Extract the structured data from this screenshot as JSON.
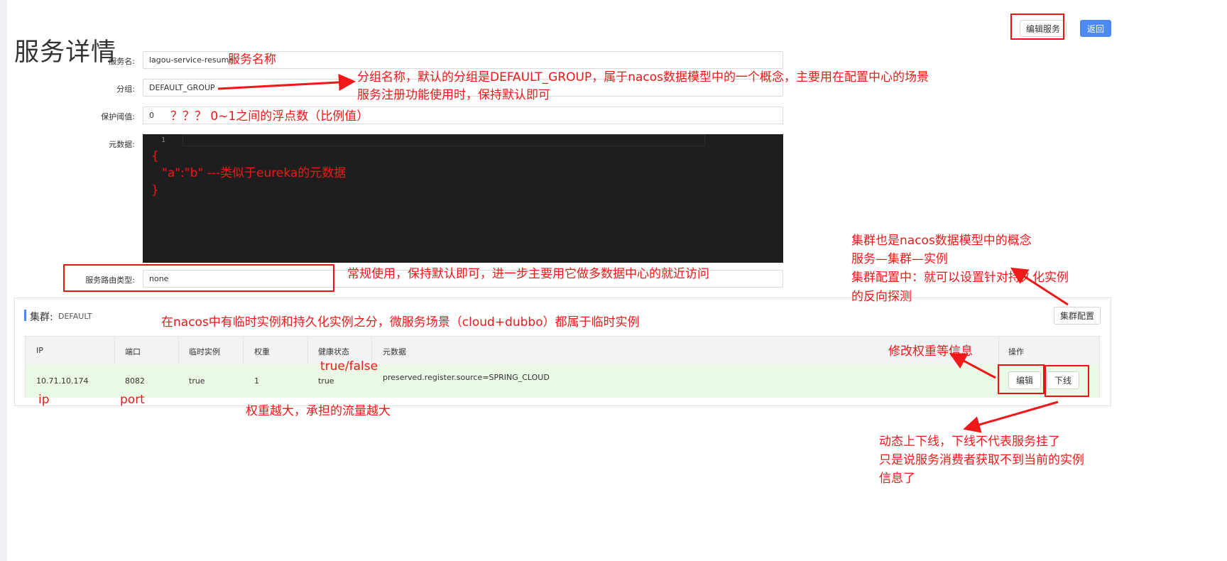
{
  "page": {
    "title": "服务详情"
  },
  "header": {
    "edit_service": "编辑服务",
    "back": "返回"
  },
  "form": {
    "service_name_label": "服务名:",
    "service_name_value": "lagou-service-resume",
    "group_label": "分组:",
    "group_value": "DEFAULT_GROUP",
    "threshold_label": "保护阈值:",
    "threshold_value": "0",
    "metadata_label": "元数据:",
    "editor_line": "1",
    "route_type_label": "服务路由类型:",
    "route_type_value": "none"
  },
  "cluster": {
    "title": "集群:",
    "name": "DEFAULT",
    "config_button": "集群配置",
    "columns": [
      "IP",
      "端口",
      "临时实例",
      "权重",
      "健康状态",
      "元数据",
      "操作"
    ],
    "rows": [
      {
        "ip": "10.71.10.174",
        "port": "8082",
        "ephemeral": "true",
        "weight": "1",
        "healthy": "true",
        "metadata": "preserved.register.source=SPRING_CLOUD",
        "edit": "编辑",
        "offline": "下线"
      }
    ]
  },
  "annotations": {
    "service_name": "服务名称",
    "group_line1": "分组名称，默认的分组是DEFAULT_GROUP，属于nacos数据模型中的一个概念，主要用在配置中心的场景",
    "group_line2": "服务注册功能使用时，保持默认即可",
    "threshold": "？？？ 0~1之间的浮点数（比例值）",
    "meta_open": "{",
    "meta_body": "\"a\":\"b\"  ---类似于eureka的元数据",
    "meta_close": "}",
    "route": "常规使用，保持默认即可，进一步主要用它做多数据中心的就近访问",
    "cluster_line1": "集群也是nacos数据模型中的概念",
    "cluster_line2": "服务—集群—实例",
    "cluster_line3": "集群配置中：就可以设置针对持久化实例",
    "cluster_line4": "的反向探测",
    "ephemeral_note": "在nacos中有临时实例和持久化实例之分，微服务场景（cloud+dubbo）都属于临时实例",
    "healthy_note": "true/false",
    "ip_note": "ip",
    "port_note": "port",
    "weight_note": "权重越大，承担的流量越大",
    "edit_note": "修改权重等信息",
    "offline_line1": "动态上下线，下线不代表服务挂了",
    "offline_line2": "只是说服务消费者获取不到当前的实例",
    "offline_line3": "信息了"
  },
  "colors": {
    "accent": "#4d8af0",
    "annotation": "#f01818",
    "row_bg": "#eaf9e6",
    "editor_bg": "#1e1e1e"
  }
}
